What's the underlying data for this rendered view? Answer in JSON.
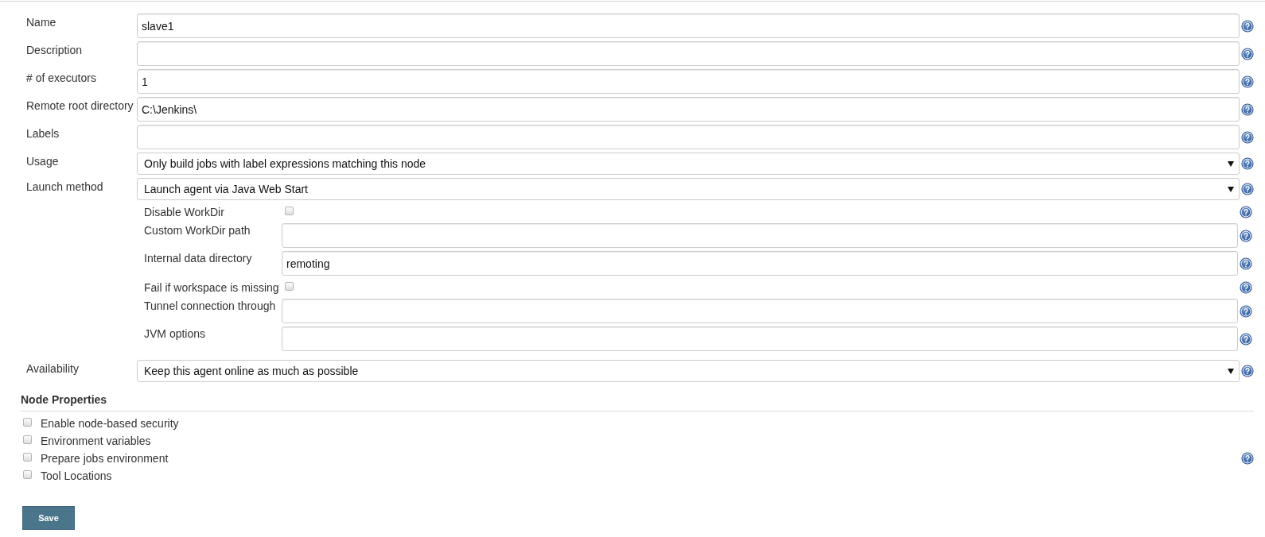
{
  "form": {
    "fields": [
      {
        "kind": "text",
        "label": "Name",
        "value": "slave1"
      },
      {
        "kind": "text",
        "label": "Description"
      },
      {
        "kind": "text",
        "label": "# of executors",
        "value": "1"
      },
      {
        "kind": "text",
        "label": "Remote root directory",
        "value": "C:\\Jenkins\\"
      },
      {
        "kind": "text",
        "label": "Labels"
      },
      {
        "kind": "select",
        "label": "Usage",
        "value": "Only build jobs with label expressions matching this node"
      },
      {
        "kind": "select",
        "label": "Launch method",
        "value": "Launch agent via Java Web Start",
        "sub_fields": [
          {
            "kind": "checkbox",
            "label": "Disable WorkDir",
            "checked": false
          },
          {
            "kind": "text",
            "label": "Custom WorkDir path"
          },
          {
            "kind": "text",
            "label": "Internal data directory",
            "value": "remoting"
          },
          {
            "kind": "checkbox",
            "label": "Fail if workspace is missing",
            "checked": false
          },
          {
            "kind": "text",
            "label": "Tunnel connection through"
          },
          {
            "kind": "text",
            "label": "JVM options"
          }
        ]
      },
      {
        "kind": "select",
        "label": "Availability",
        "value": "Keep this agent online as much as possible"
      }
    ]
  },
  "node_properties": {
    "title": "Node Properties",
    "items": [
      {
        "label": "Enable node-based security",
        "checked": false,
        "help": false
      },
      {
        "label": "Environment variables",
        "checked": false,
        "help": false
      },
      {
        "label": "Prepare jobs environment",
        "checked": false,
        "help": true
      },
      {
        "label": "Tool Locations",
        "checked": false,
        "help": false
      }
    ]
  },
  "save_button": {
    "label": "Save"
  }
}
